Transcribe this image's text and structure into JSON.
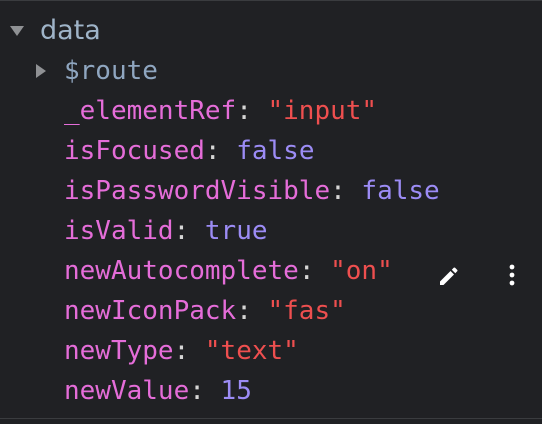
{
  "section": {
    "title": "data",
    "expanded": true
  },
  "rows": [
    {
      "key": "$route",
      "colon": "",
      "value": "",
      "type": "object",
      "collapsed": true
    },
    {
      "key": "_elementRef",
      "colon": ":",
      "value": "\"input\"",
      "type": "string"
    },
    {
      "key": "isFocused",
      "colon": ":",
      "value": "false",
      "type": "boolean"
    },
    {
      "key": "isPasswordVisible",
      "colon": ":",
      "value": "false",
      "type": "boolean"
    },
    {
      "key": "isValid",
      "colon": ":",
      "value": "true",
      "type": "boolean"
    },
    {
      "key": "newAutocomplete",
      "colon": ":",
      "value": "\"on\"",
      "type": "string",
      "hovered": true
    },
    {
      "key": "newIconPack",
      "colon": ":",
      "value": "\"fas\"",
      "type": "string"
    },
    {
      "key": "newType",
      "colon": ":",
      "value": "\"text\"",
      "type": "string"
    },
    {
      "key": "newValue",
      "colon": ":",
      "value": "15",
      "type": "number"
    }
  ],
  "actions": {
    "edit_icon": "pencil-icon",
    "more_icon": "more-vertical-icon"
  },
  "colors": {
    "background": "#202124",
    "key": "#e56dd9",
    "string": "#ee4f4f",
    "boolean": "#9c8cf5",
    "number": "#9c8cf5",
    "section_title": "#9fb4c8"
  }
}
